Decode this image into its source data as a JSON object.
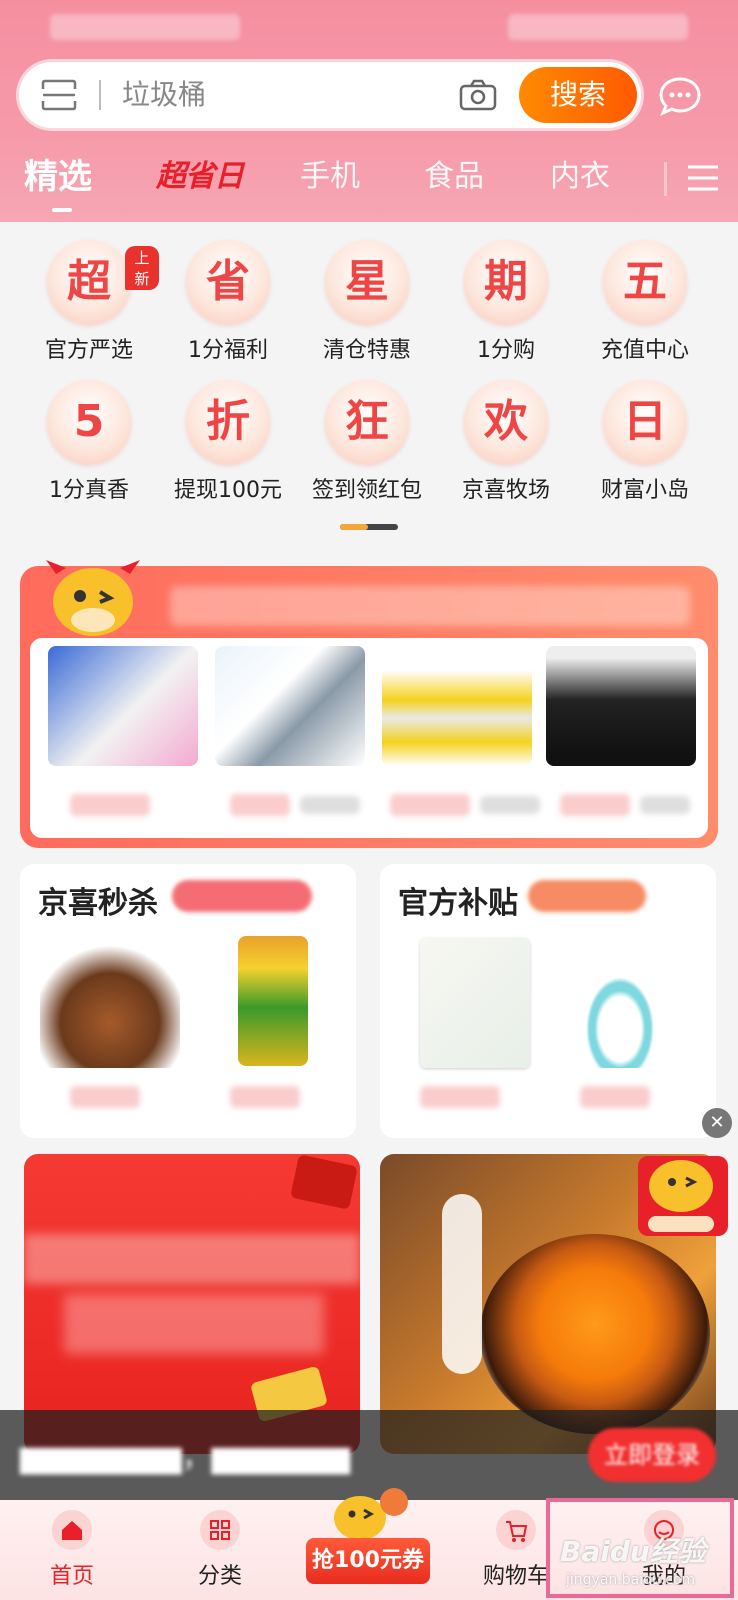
{
  "search": {
    "placeholder": "垃圾桶",
    "button_label": "搜索"
  },
  "tabs": [
    {
      "label": "精选"
    },
    {
      "label": "超省日"
    },
    {
      "label": "手机"
    },
    {
      "label": "食品"
    },
    {
      "label": "内衣"
    }
  ],
  "grid": {
    "badge": "上新",
    "items": [
      {
        "glyph": "超",
        "label": "官方严选"
      },
      {
        "glyph": "省",
        "label": "1分福利"
      },
      {
        "glyph": "星",
        "label": "清仓特惠"
      },
      {
        "glyph": "期",
        "label": "1分购"
      },
      {
        "glyph": "五",
        "label": "充值中心"
      },
      {
        "glyph": "5",
        "label": "1分真香"
      },
      {
        "glyph": "折",
        "label": "提现100元"
      },
      {
        "glyph": "狂",
        "label": "签到领红包"
      },
      {
        "glyph": "欢",
        "label": "京喜牧场"
      },
      {
        "glyph": "日",
        "label": "财富小岛"
      }
    ]
  },
  "cards": {
    "left_title": "京喜秒杀",
    "right_title": "官方补贴"
  },
  "float": {
    "close": "✕"
  },
  "bottom_nav": {
    "items": [
      {
        "label": "首页"
      },
      {
        "label": "分类"
      },
      {
        "label": "购物车"
      },
      {
        "label": "我的"
      }
    ],
    "coupon_label": "抢100元券"
  },
  "login_bar": {
    "button_label": "立即登录"
  },
  "watermark": {
    "text": "Baidu经验",
    "sub": "jingyan.baidu.com"
  },
  "colors": {
    "accent": "#e8202a",
    "header_pink": "#f69aaa",
    "search_orange": "#ff6a00"
  }
}
